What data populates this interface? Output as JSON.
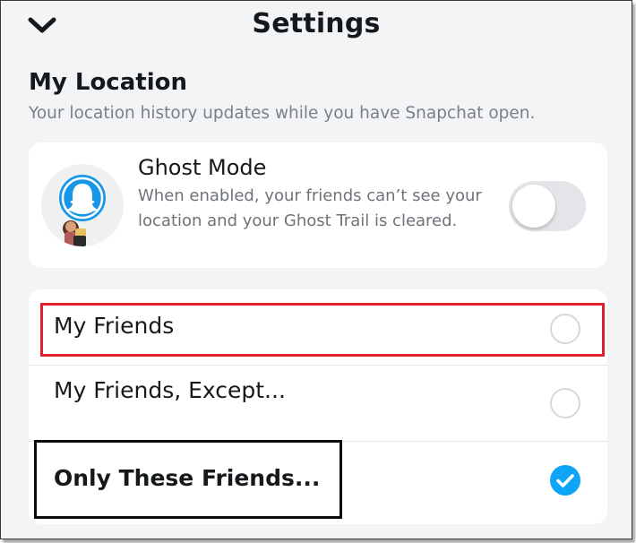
{
  "header": {
    "title": "Settings",
    "back_icon": "chevron-down-icon"
  },
  "section": {
    "title": "My Location",
    "subtitle": "Your location history updates while you have Snapchat open."
  },
  "ghost_mode": {
    "title": "Ghost Mode",
    "description": "When enabled, your friends can’t see your location and your Ghost Trail is cleared.",
    "enabled": false,
    "avatar_icon": "snapchat-ghost-bitmoji-icon"
  },
  "options": [
    {
      "label": "My Friends",
      "selected": false
    },
    {
      "label": "My Friends, Except...",
      "selected": false
    },
    {
      "label": "Only These Friends...",
      "selected": true
    }
  ],
  "colors": {
    "selected_blue": "#0ea5f7",
    "highlight_red": "#e0202f",
    "highlight_black": "#0b0b0b"
  }
}
